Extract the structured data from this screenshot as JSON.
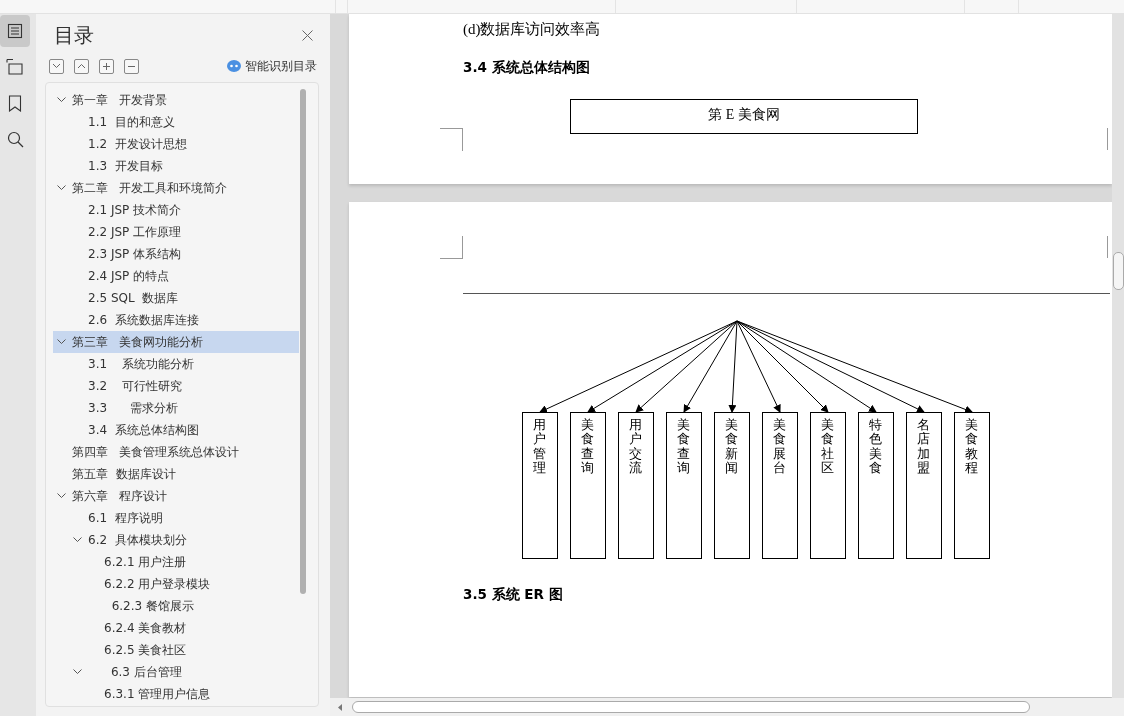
{
  "rail": [
    {
      "kind": "contents",
      "selected": true
    },
    {
      "kind": "outline",
      "selected": false
    },
    {
      "kind": "bookmark",
      "selected": false
    },
    {
      "kind": "search",
      "selected": false
    }
  ],
  "toc_panel": {
    "title": "目录",
    "smart_button": "智能识别目录",
    "items": [
      {
        "text": "第一章   开发背景",
        "selected": false,
        "expanded": true,
        "children": [
          {
            "text": "1.1  目的和意义",
            "selected": false
          },
          {
            "text": "1.2  开发设计思想",
            "selected": false
          },
          {
            "text": "1.3  开发目标",
            "selected": false
          }
        ]
      },
      {
        "text": "第二章   开发工具和环境简介",
        "selected": false,
        "expanded": true,
        "children": [
          {
            "text": "2.1 JSP 技术简介",
            "selected": false
          },
          {
            "text": "2.2 JSP 工作原理",
            "selected": false
          },
          {
            "text": "2.3 JSP 体系结构",
            "selected": false
          },
          {
            "text": "2.4 JSP 的特点",
            "selected": false
          },
          {
            "text": "2.5 SQL  数据库",
            "selected": false
          },
          {
            "text": "2.6  系统数据库连接",
            "selected": false
          }
        ]
      },
      {
        "text": "第三章   美食网功能分析",
        "selected": true,
        "expanded": true,
        "children": [
          {
            "text": "3.1    系统功能分析",
            "selected": false
          },
          {
            "text": "3.2    可行性研究",
            "selected": false
          },
          {
            "text": "3.3      需求分析",
            "selected": false
          },
          {
            "text": "3.4  系统总体结构图",
            "selected": false
          }
        ]
      },
      {
        "text": "第四章   美食管理系统总体设计",
        "selected": false
      },
      {
        "text": "第五章  数据库设计",
        "selected": false
      },
      {
        "text": "第六章   程序设计",
        "selected": false,
        "expanded": true,
        "children": [
          {
            "text": "6.1  程序说明",
            "selected": false
          },
          {
            "text": "6.2  具体模块划分",
            "selected": false,
            "expanded": true,
            "children": [
              {
                "text": "6.2.1 用户注册",
                "selected": false
              },
              {
                "text": "6.2.2 用户登录模块",
                "selected": false
              },
              {
                "text": "  6.2.3 餐馆展示",
                "selected": false
              },
              {
                "text": "6.2.4 美食教材",
                "selected": false
              },
              {
                "text": "6.2.5 美食社区",
                "selected": false
              }
            ]
          },
          {
            "text": "      6.3 后台管理",
            "selected": false,
            "expanded": true,
            "children": [
              {
                "text": "6.3.1 管理用户信息",
                "selected": false
              }
            ]
          }
        ]
      }
    ]
  },
  "document": {
    "page_1": {
      "paragraph": "(d)数据库访问效率高",
      "heading": "3.4 系统总体结构图",
      "root_node": "第 E 美食网"
    },
    "page_2": {
      "modules": [
        "用户管理",
        "美食查询",
        "用户交流",
        "美食查询",
        "美食新闻",
        "美食展台",
        "美食社区",
        "特色美食",
        "名店加盟",
        "美食教程"
      ],
      "heading": "3.5 系统 ER 图"
    }
  }
}
